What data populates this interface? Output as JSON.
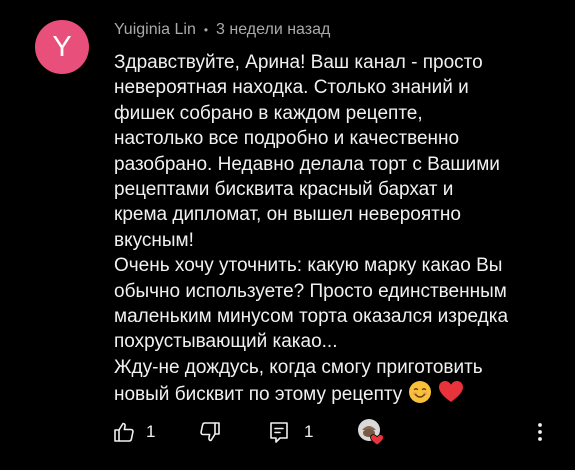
{
  "comment": {
    "avatar_letter": "Y",
    "avatar_color": "#e84f7a",
    "author": "Yuiginia Lin",
    "separator": "•",
    "timestamp": "3 недели назад",
    "lines": [
      "Здравствуйте, Арина! Ваш канал - просто",
      "невероятная находка. Столько знаний и",
      "фишек собрано в каждом рецепте,",
      "настолько все подробно и качественно",
      "разобрано. Недавно делала торт с Вашими",
      "рецептами бисквита красный бархат и",
      "крема дипломат, он вышел невероятно",
      "вкусным!",
      "Очень хочу уточнить: какую марку какао Вы",
      "обычно используете? Просто единственным",
      "маленьким минусом торта оказался изредка",
      "похрустывающий какао...",
      "Жду-не дождусь, когда смогу приготовить",
      "новый бисквит по этому рецепту"
    ],
    "trailing_emojis": [
      "smiling-face-icon",
      "red-heart-icon"
    ]
  },
  "actions": {
    "like_count": "1",
    "reply_count": "1",
    "like_icon": "thumbs-up-icon",
    "dislike_icon": "thumbs-down-icon",
    "reply_icon": "reply-icon",
    "creator_heart_icon": "creator-heart-icon",
    "more_icon": "more-vertical-icon"
  }
}
